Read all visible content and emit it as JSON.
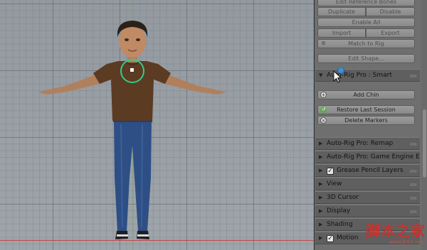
{
  "panel": {
    "buttons": {
      "edit_reference_bones": "Edit Reference Bones",
      "duplicate": "Duplicate",
      "disable": "Disable",
      "enable_all": "Enable All",
      "import": "Import",
      "export": "Export",
      "match_to_rig": "Match to Rig",
      "edit_shape": "Edit Shape...",
      "add_chin": "Add Chin",
      "restore_last_session": "Restore Last Session",
      "delete_markers": "Delete Markers"
    },
    "smart_section": "Auto-Rig Pro : Smart",
    "sections": [
      {
        "label": "Auto-Rig Pro: Remap",
        "checkbox": false
      },
      {
        "label": "Auto-Rig Pro: Game Engine E",
        "checkbox": false
      },
      {
        "label": "Grease Pencil Layers",
        "checkbox": true
      },
      {
        "label": "View",
        "checkbox": false
      },
      {
        "label": "3D Cursor",
        "checkbox": false
      },
      {
        "label": "Display",
        "checkbox": false
      },
      {
        "label": "Shading",
        "checkbox": false
      },
      {
        "label": "Motion",
        "checkbox": true
      }
    ]
  },
  "watermark": {
    "title": "脚本之家",
    "url": "www.jb51.net"
  },
  "colors": {
    "viewport_bg": "#a3aab0",
    "panel_bg": "#6f6f6f",
    "marker_green": "#2fcf8a",
    "watermark_red": "#c8322d"
  }
}
